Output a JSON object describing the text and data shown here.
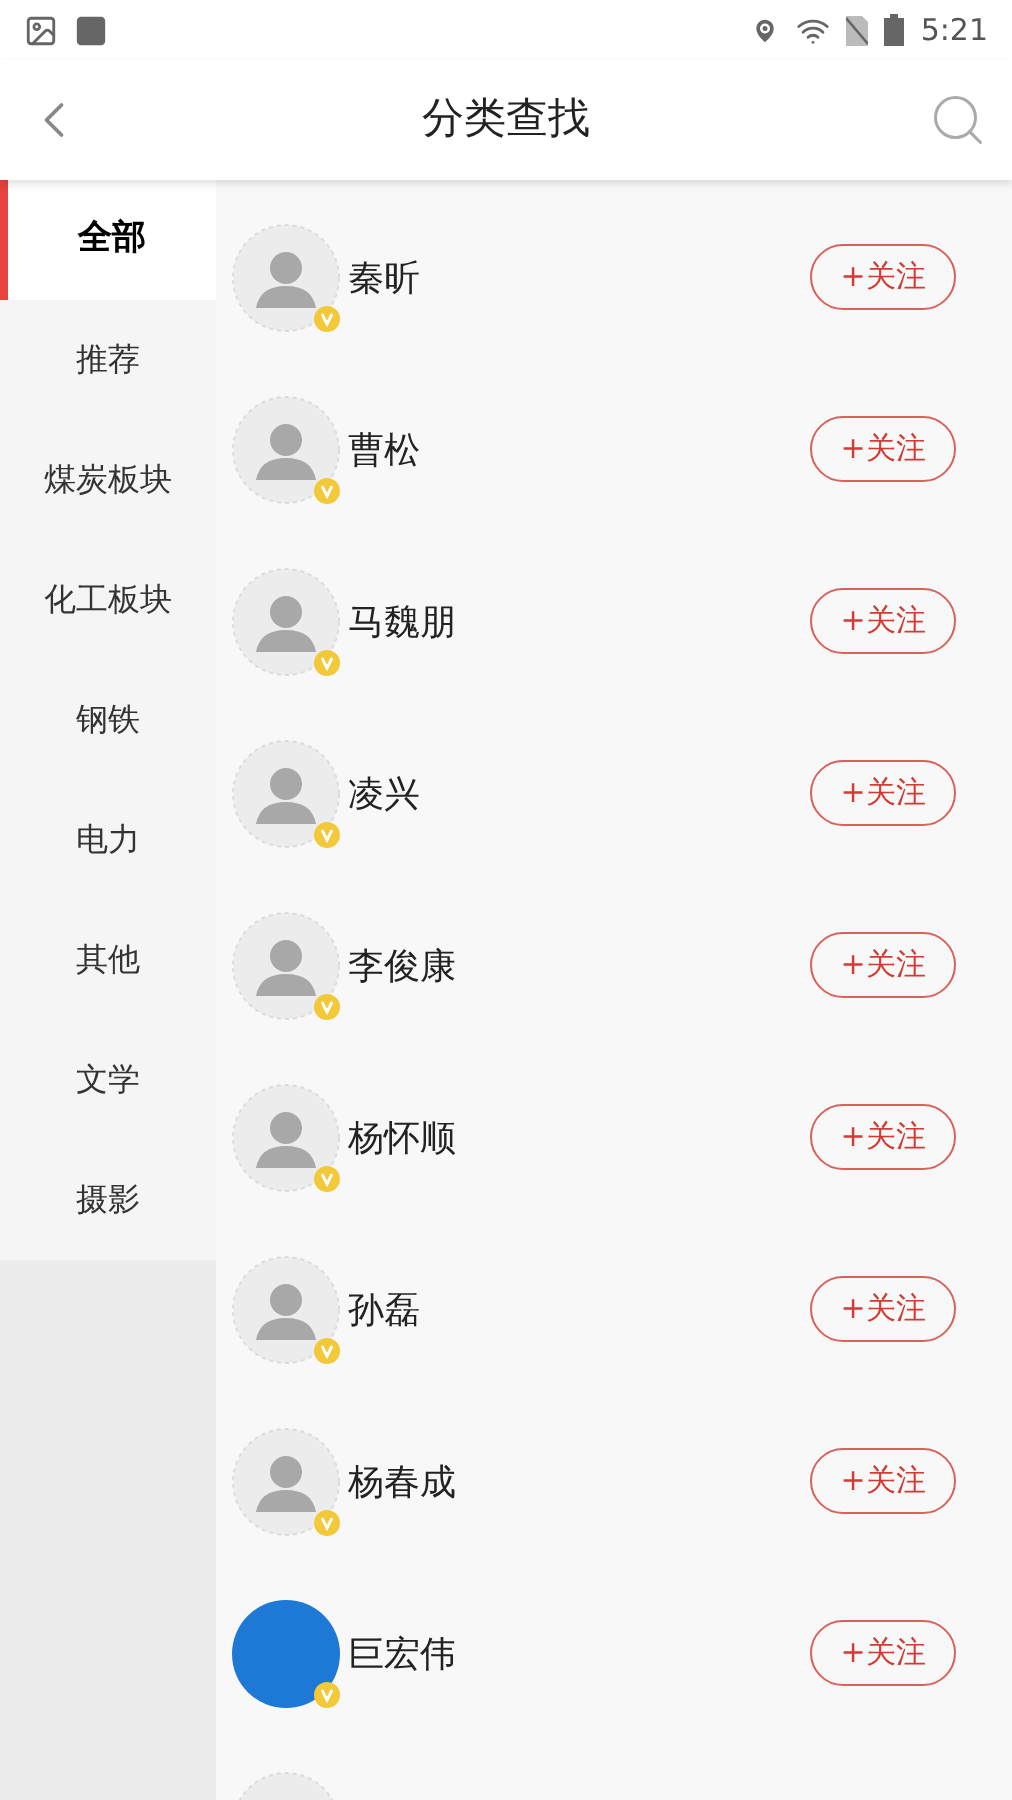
{
  "status_bar": {
    "time": "5:21"
  },
  "header": {
    "title": "分类查找"
  },
  "sidebar": {
    "items": [
      {
        "label": "全部",
        "selected": true
      },
      {
        "label": "推荐",
        "selected": false
      },
      {
        "label": "煤炭板块",
        "selected": false
      },
      {
        "label": "化工板块",
        "selected": false
      },
      {
        "label": "钢铁",
        "selected": false
      },
      {
        "label": "电力",
        "selected": false
      },
      {
        "label": "其他",
        "selected": false
      },
      {
        "label": "文学",
        "selected": false
      },
      {
        "label": "摄影",
        "selected": false
      }
    ]
  },
  "users": [
    {
      "name": "秦昕",
      "kind": "placeholder",
      "follow": "+关注"
    },
    {
      "name": "曹松",
      "kind": "placeholder",
      "follow": "+关注"
    },
    {
      "name": "马魏朋",
      "kind": "placeholder",
      "follow": "+关注"
    },
    {
      "name": "凌兴",
      "kind": "placeholder",
      "follow": "+关注"
    },
    {
      "name": "李俊康",
      "kind": "placeholder",
      "follow": "+关注"
    },
    {
      "name": "杨怀顺",
      "kind": "placeholder",
      "follow": "+关注"
    },
    {
      "name": "孙磊",
      "kind": "placeholder",
      "follow": "+关注"
    },
    {
      "name": "杨春成",
      "kind": "placeholder",
      "follow": "+关注"
    },
    {
      "name": "巨宏伟",
      "kind": "custom",
      "follow": "+关注"
    },
    {
      "kind": "placeholder"
    }
  ]
}
